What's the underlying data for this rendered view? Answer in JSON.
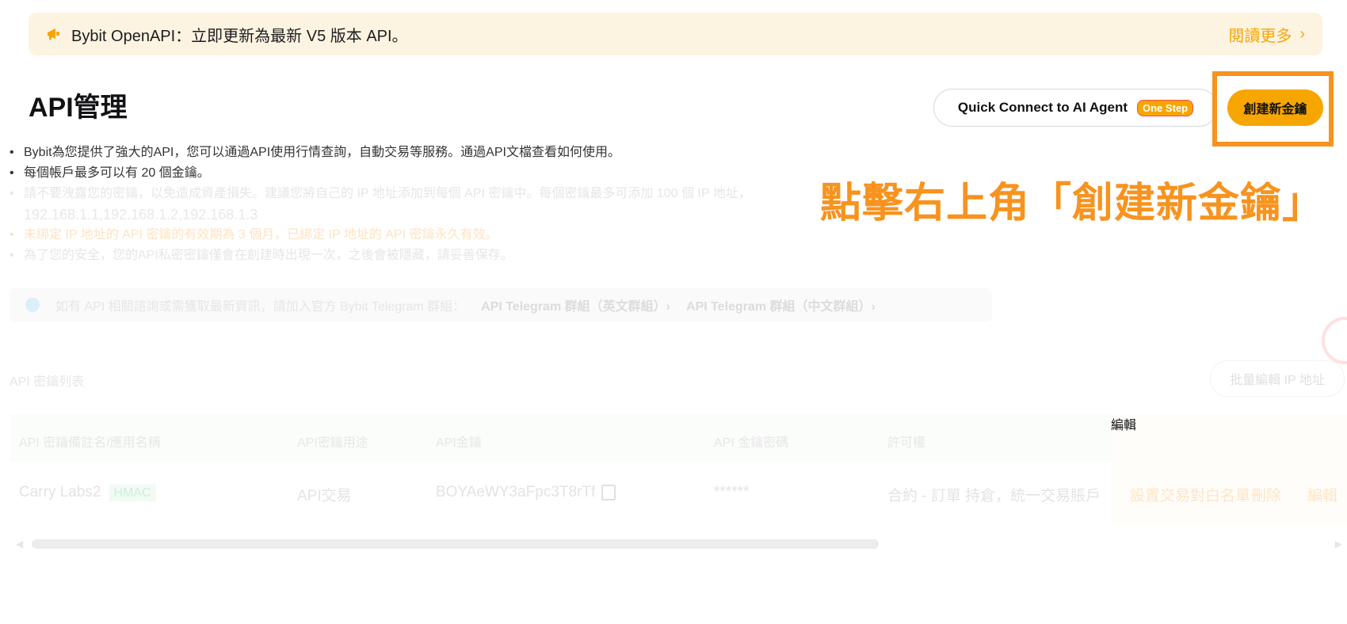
{
  "banner": {
    "icon": "megaphone-icon",
    "message": "Bybit OpenAPI：立即更新為最新 V5 版本 API。",
    "read_more": "閱讀更多",
    "chevron": "›"
  },
  "header": {
    "title": "API管理",
    "quick_connect_label": "Quick Connect to AI Agent",
    "quick_connect_badge": "One Step",
    "create_button": "創建新金鑰"
  },
  "annotation": "點擊右上角「創建新金鑰」",
  "info": {
    "bullet1": "Bybit為您提供了強大的API，您可以通過API使用行情查詢，自動交易等服務。通過API文檔查看如何使用。",
    "bullet2": "每個帳戶最多可以有 20 個金鑰。",
    "bullet3": "請不要洩露您的密鑰，以免造成資產損失。建議您將自己的 IP 地址添加到每個 API 密鑰中。每個密鑰最多可添加 100 個 IP 地址，",
    "bullet3_ips": "192.168.1.1,192.168.1.2,192.168.1.3",
    "bullet4": "未綁定 IP 地址的 API 密鑰的有效期為 3 個月，已綁定 IP 地址的 API 密鑰永久有效。",
    "bullet5": "為了您的安全，您的API私密密鑰僅會在創建時出現一次，之後會被隱藏，請妥善保存。"
  },
  "telegram": {
    "text": "如有 API 相關諮詢或需獲取最新資訊，請加入官方 Bybit Telegram 群組：",
    "link_en": "API Telegram 群組（英文群組）›",
    "link_zh": "API Telegram 群組（中文群組）›"
  },
  "key_list": {
    "title": "API 密鑰列表",
    "batch_edit": "批量編輯 IP 地址",
    "columns": [
      "API 密鑰備註名/應用名稱",
      "API密鑰用途",
      "API金鑰",
      "API 金鑰密碼",
      "許可權",
      "編輯"
    ],
    "rows": [
      {
        "name": "Carry Labs2",
        "tag": "HMAC",
        "usage": "API交易",
        "key": "BOYAeWY3aFpc3T8rTf",
        "secret": "******",
        "permissions": "合約 - 訂單 持倉，統一交易賬戶",
        "actions": [
          "設置交易對白名單",
          "刪除",
          "編輯"
        ]
      }
    ]
  }
}
